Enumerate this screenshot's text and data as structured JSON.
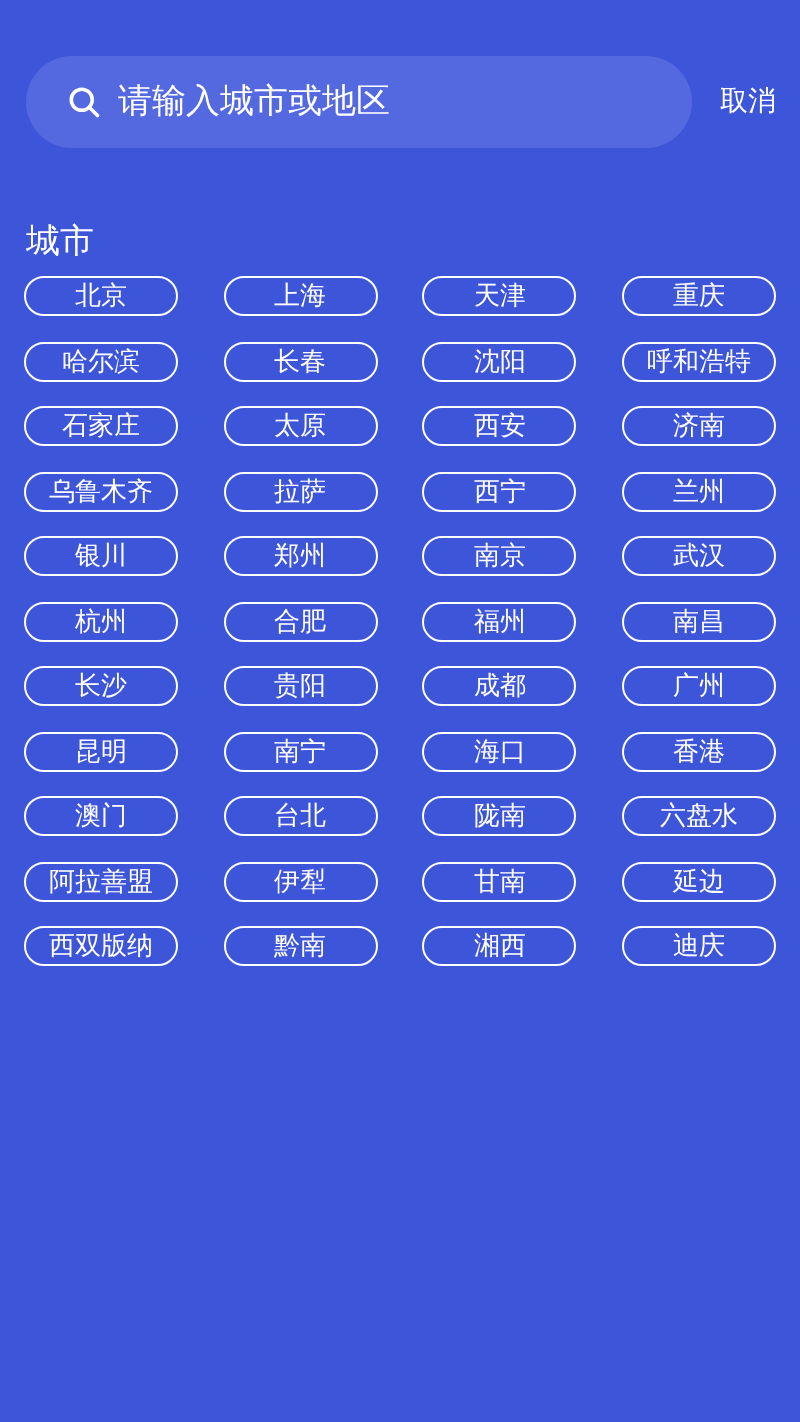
{
  "search": {
    "placeholder": "请输入城市或地区"
  },
  "cancel": "取消",
  "section_title": "城市",
  "cities": [
    "北京",
    "上海",
    "天津",
    "重庆",
    "哈尔滨",
    "长春",
    "沈阳",
    "呼和浩特",
    "石家庄",
    "太原",
    "西安",
    "济南",
    "乌鲁木齐",
    "拉萨",
    "西宁",
    "兰州",
    "银川",
    "郑州",
    "南京",
    "武汉",
    "杭州",
    "合肥",
    "福州",
    "南昌",
    "长沙",
    "贵阳",
    "成都",
    "广州",
    "昆明",
    "南宁",
    "海口",
    "香港",
    "澳门",
    "台北",
    "陇南",
    "六盘水",
    "阿拉善盟",
    "伊犁",
    "甘南",
    "延边",
    "西双版纳",
    "黔南",
    "湘西",
    "迪庆"
  ]
}
